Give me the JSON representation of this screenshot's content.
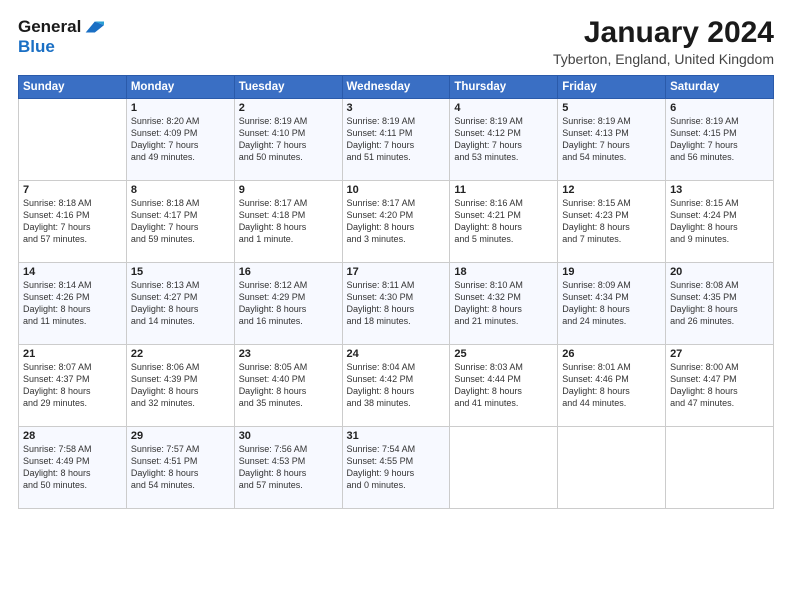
{
  "header": {
    "logo_line1": "General",
    "logo_line2": "Blue",
    "month": "January 2024",
    "location": "Tyberton, England, United Kingdom"
  },
  "days_header": [
    "Sunday",
    "Monday",
    "Tuesday",
    "Wednesday",
    "Thursday",
    "Friday",
    "Saturday"
  ],
  "weeks": [
    [
      {
        "day": "",
        "info": ""
      },
      {
        "day": "1",
        "info": "Sunrise: 8:20 AM\nSunset: 4:09 PM\nDaylight: 7 hours\nand 49 minutes."
      },
      {
        "day": "2",
        "info": "Sunrise: 8:19 AM\nSunset: 4:10 PM\nDaylight: 7 hours\nand 50 minutes."
      },
      {
        "day": "3",
        "info": "Sunrise: 8:19 AM\nSunset: 4:11 PM\nDaylight: 7 hours\nand 51 minutes."
      },
      {
        "day": "4",
        "info": "Sunrise: 8:19 AM\nSunset: 4:12 PM\nDaylight: 7 hours\nand 53 minutes."
      },
      {
        "day": "5",
        "info": "Sunrise: 8:19 AM\nSunset: 4:13 PM\nDaylight: 7 hours\nand 54 minutes."
      },
      {
        "day": "6",
        "info": "Sunrise: 8:19 AM\nSunset: 4:15 PM\nDaylight: 7 hours\nand 56 minutes."
      }
    ],
    [
      {
        "day": "7",
        "info": "Sunrise: 8:18 AM\nSunset: 4:16 PM\nDaylight: 7 hours\nand 57 minutes."
      },
      {
        "day": "8",
        "info": "Sunrise: 8:18 AM\nSunset: 4:17 PM\nDaylight: 7 hours\nand 59 minutes."
      },
      {
        "day": "9",
        "info": "Sunrise: 8:17 AM\nSunset: 4:18 PM\nDaylight: 8 hours\nand 1 minute."
      },
      {
        "day": "10",
        "info": "Sunrise: 8:17 AM\nSunset: 4:20 PM\nDaylight: 8 hours\nand 3 minutes."
      },
      {
        "day": "11",
        "info": "Sunrise: 8:16 AM\nSunset: 4:21 PM\nDaylight: 8 hours\nand 5 minutes."
      },
      {
        "day": "12",
        "info": "Sunrise: 8:15 AM\nSunset: 4:23 PM\nDaylight: 8 hours\nand 7 minutes."
      },
      {
        "day": "13",
        "info": "Sunrise: 8:15 AM\nSunset: 4:24 PM\nDaylight: 8 hours\nand 9 minutes."
      }
    ],
    [
      {
        "day": "14",
        "info": "Sunrise: 8:14 AM\nSunset: 4:26 PM\nDaylight: 8 hours\nand 11 minutes."
      },
      {
        "day": "15",
        "info": "Sunrise: 8:13 AM\nSunset: 4:27 PM\nDaylight: 8 hours\nand 14 minutes."
      },
      {
        "day": "16",
        "info": "Sunrise: 8:12 AM\nSunset: 4:29 PM\nDaylight: 8 hours\nand 16 minutes."
      },
      {
        "day": "17",
        "info": "Sunrise: 8:11 AM\nSunset: 4:30 PM\nDaylight: 8 hours\nand 18 minutes."
      },
      {
        "day": "18",
        "info": "Sunrise: 8:10 AM\nSunset: 4:32 PM\nDaylight: 8 hours\nand 21 minutes."
      },
      {
        "day": "19",
        "info": "Sunrise: 8:09 AM\nSunset: 4:34 PM\nDaylight: 8 hours\nand 24 minutes."
      },
      {
        "day": "20",
        "info": "Sunrise: 8:08 AM\nSunset: 4:35 PM\nDaylight: 8 hours\nand 26 minutes."
      }
    ],
    [
      {
        "day": "21",
        "info": "Sunrise: 8:07 AM\nSunset: 4:37 PM\nDaylight: 8 hours\nand 29 minutes."
      },
      {
        "day": "22",
        "info": "Sunrise: 8:06 AM\nSunset: 4:39 PM\nDaylight: 8 hours\nand 32 minutes."
      },
      {
        "day": "23",
        "info": "Sunrise: 8:05 AM\nSunset: 4:40 PM\nDaylight: 8 hours\nand 35 minutes."
      },
      {
        "day": "24",
        "info": "Sunrise: 8:04 AM\nSunset: 4:42 PM\nDaylight: 8 hours\nand 38 minutes."
      },
      {
        "day": "25",
        "info": "Sunrise: 8:03 AM\nSunset: 4:44 PM\nDaylight: 8 hours\nand 41 minutes."
      },
      {
        "day": "26",
        "info": "Sunrise: 8:01 AM\nSunset: 4:46 PM\nDaylight: 8 hours\nand 44 minutes."
      },
      {
        "day": "27",
        "info": "Sunrise: 8:00 AM\nSunset: 4:47 PM\nDaylight: 8 hours\nand 47 minutes."
      }
    ],
    [
      {
        "day": "28",
        "info": "Sunrise: 7:58 AM\nSunset: 4:49 PM\nDaylight: 8 hours\nand 50 minutes."
      },
      {
        "day": "29",
        "info": "Sunrise: 7:57 AM\nSunset: 4:51 PM\nDaylight: 8 hours\nand 54 minutes."
      },
      {
        "day": "30",
        "info": "Sunrise: 7:56 AM\nSunset: 4:53 PM\nDaylight: 8 hours\nand 57 minutes."
      },
      {
        "day": "31",
        "info": "Sunrise: 7:54 AM\nSunset: 4:55 PM\nDaylight: 9 hours\nand 0 minutes."
      },
      {
        "day": "",
        "info": ""
      },
      {
        "day": "",
        "info": ""
      },
      {
        "day": "",
        "info": ""
      }
    ]
  ]
}
